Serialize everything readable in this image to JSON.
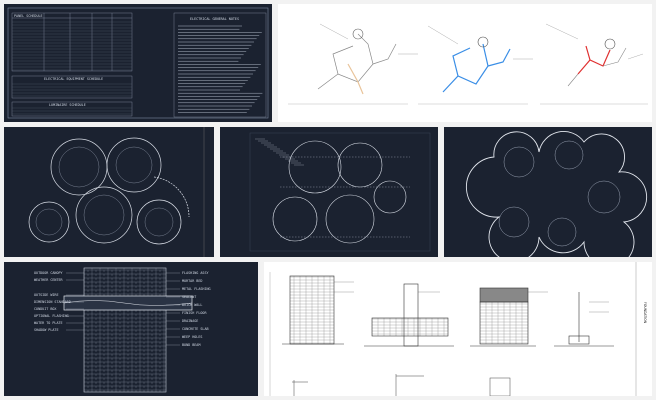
{
  "gallery": {
    "colors": {
      "sheet_dark": "#1b2230",
      "sheet_light": "#ffffff",
      "line_light": "#d8dde6",
      "water_blue": "#3a8ee6",
      "hot_red": "#e03030",
      "border": "#f2f2f2"
    },
    "panels": [
      {
        "id": "schedule-sheet",
        "theme": "dark",
        "title": "ELECTRICAL GENERAL NOTES",
        "section_1": "ELECTRICAL EQUIPMENT SCHEDULE",
        "section_2": "LUMINAIRE SCHEDULE",
        "header": "PANEL SCHEDULE"
      },
      {
        "id": "plumbing-isometrics",
        "theme": "light"
      },
      {
        "id": "floor-plan-1",
        "theme": "dark"
      },
      {
        "id": "floor-plan-2",
        "theme": "dark"
      },
      {
        "id": "floor-plan-3",
        "theme": "dark"
      },
      {
        "id": "wall-section-detail",
        "theme": "dark",
        "labels_left": [
          "OUTDOOR CANOPY",
          "WEATHER CENTER",
          "OUTSIDE WIRE",
          "DIMENSION STANDARD",
          "CONDUIT BOX",
          "OPTIONAL FLASHING",
          "WATER TO PLATE",
          "SHADOW PLATE"
        ],
        "labels_right": [
          "FLASHING ASSY",
          "MORTAR BED",
          "METAL FLASHING",
          "SEALANT",
          "BRICK WALL",
          "FINISH FLOOR",
          "DRAINAGE",
          "CONCRETE SLAB",
          "WEEP HOLES",
          "BOND BEAM"
        ]
      },
      {
        "id": "foundation-details",
        "theme": "light",
        "vertical_label": "FOUNDATION"
      }
    ]
  }
}
